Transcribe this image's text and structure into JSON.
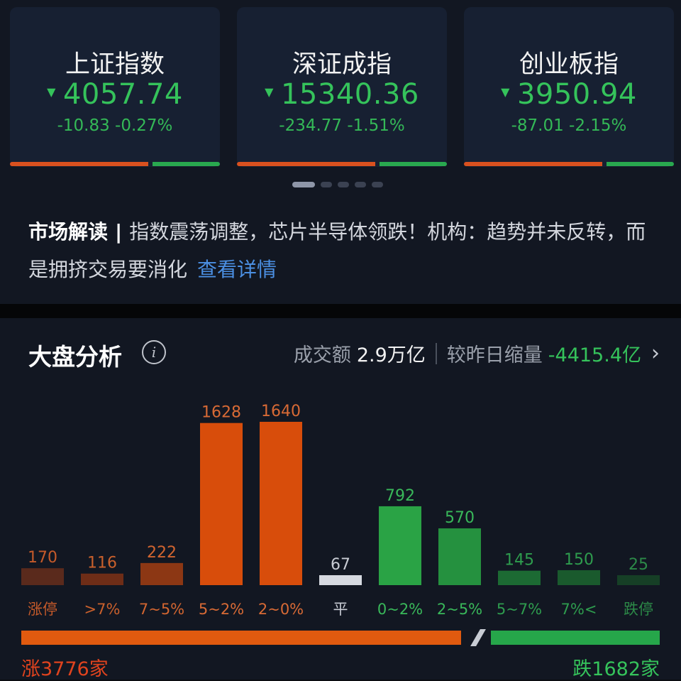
{
  "indices": [
    {
      "name": "上证指数",
      "price": "4057.74",
      "change": "-10.83 -0.27%"
    },
    {
      "name": "深证成指",
      "price": "15340.36",
      "change": "-234.77 -1.51%"
    },
    {
      "name": "创业板指",
      "price": "3950.94",
      "change": "-87.01 -2.15%"
    }
  ],
  "carousel": {
    "count": 5,
    "active": 0
  },
  "commentary": {
    "label": "市场解读",
    "separator": "|",
    "text": "指数震荡调整，芯片半导体领跌！机构：趋势并未反转，而是拥挤交易要消化",
    "link": "查看详情"
  },
  "analysis": {
    "title": "大盘分析",
    "info_icon": "i",
    "turnover_label": "成交额",
    "turnover_value": "2.9万亿",
    "compare_label": "较昨日缩量",
    "compare_value": "-4415.4亿",
    "chevron": "›"
  },
  "chart_data": {
    "type": "bar",
    "categories": [
      "涨停",
      ">7%",
      "7~5%",
      "5~2%",
      "2~0%",
      "平",
      "0~2%",
      "2~5%",
      "5~7%",
      "7%<",
      "跌停"
    ],
    "values": [
      170,
      116,
      222,
      1628,
      1640,
      67,
      792,
      570,
      145,
      150,
      25
    ],
    "colors": [
      "#5a2a1c",
      "#6e2d17",
      "#8c3714",
      "#d84d0b",
      "#d84d0b",
      "#d6d9e0",
      "#2aa345",
      "#25913f",
      "#1c6a33",
      "#1a5a2d",
      "#163f26"
    ],
    "label_colors": [
      "#c55a2a",
      "#c9602c",
      "#d26530",
      "#d86a35",
      "#d86a35",
      "#c8ccd4",
      "#39b85a",
      "#39b85a",
      "#2e9c4e",
      "#2e9c4e",
      "#2c8a48"
    ]
  },
  "updown": {
    "up_label": "涨3776家",
    "down_label": "跌1682家",
    "up_color": "#e05a0f",
    "down_color": "#26a64a"
  }
}
